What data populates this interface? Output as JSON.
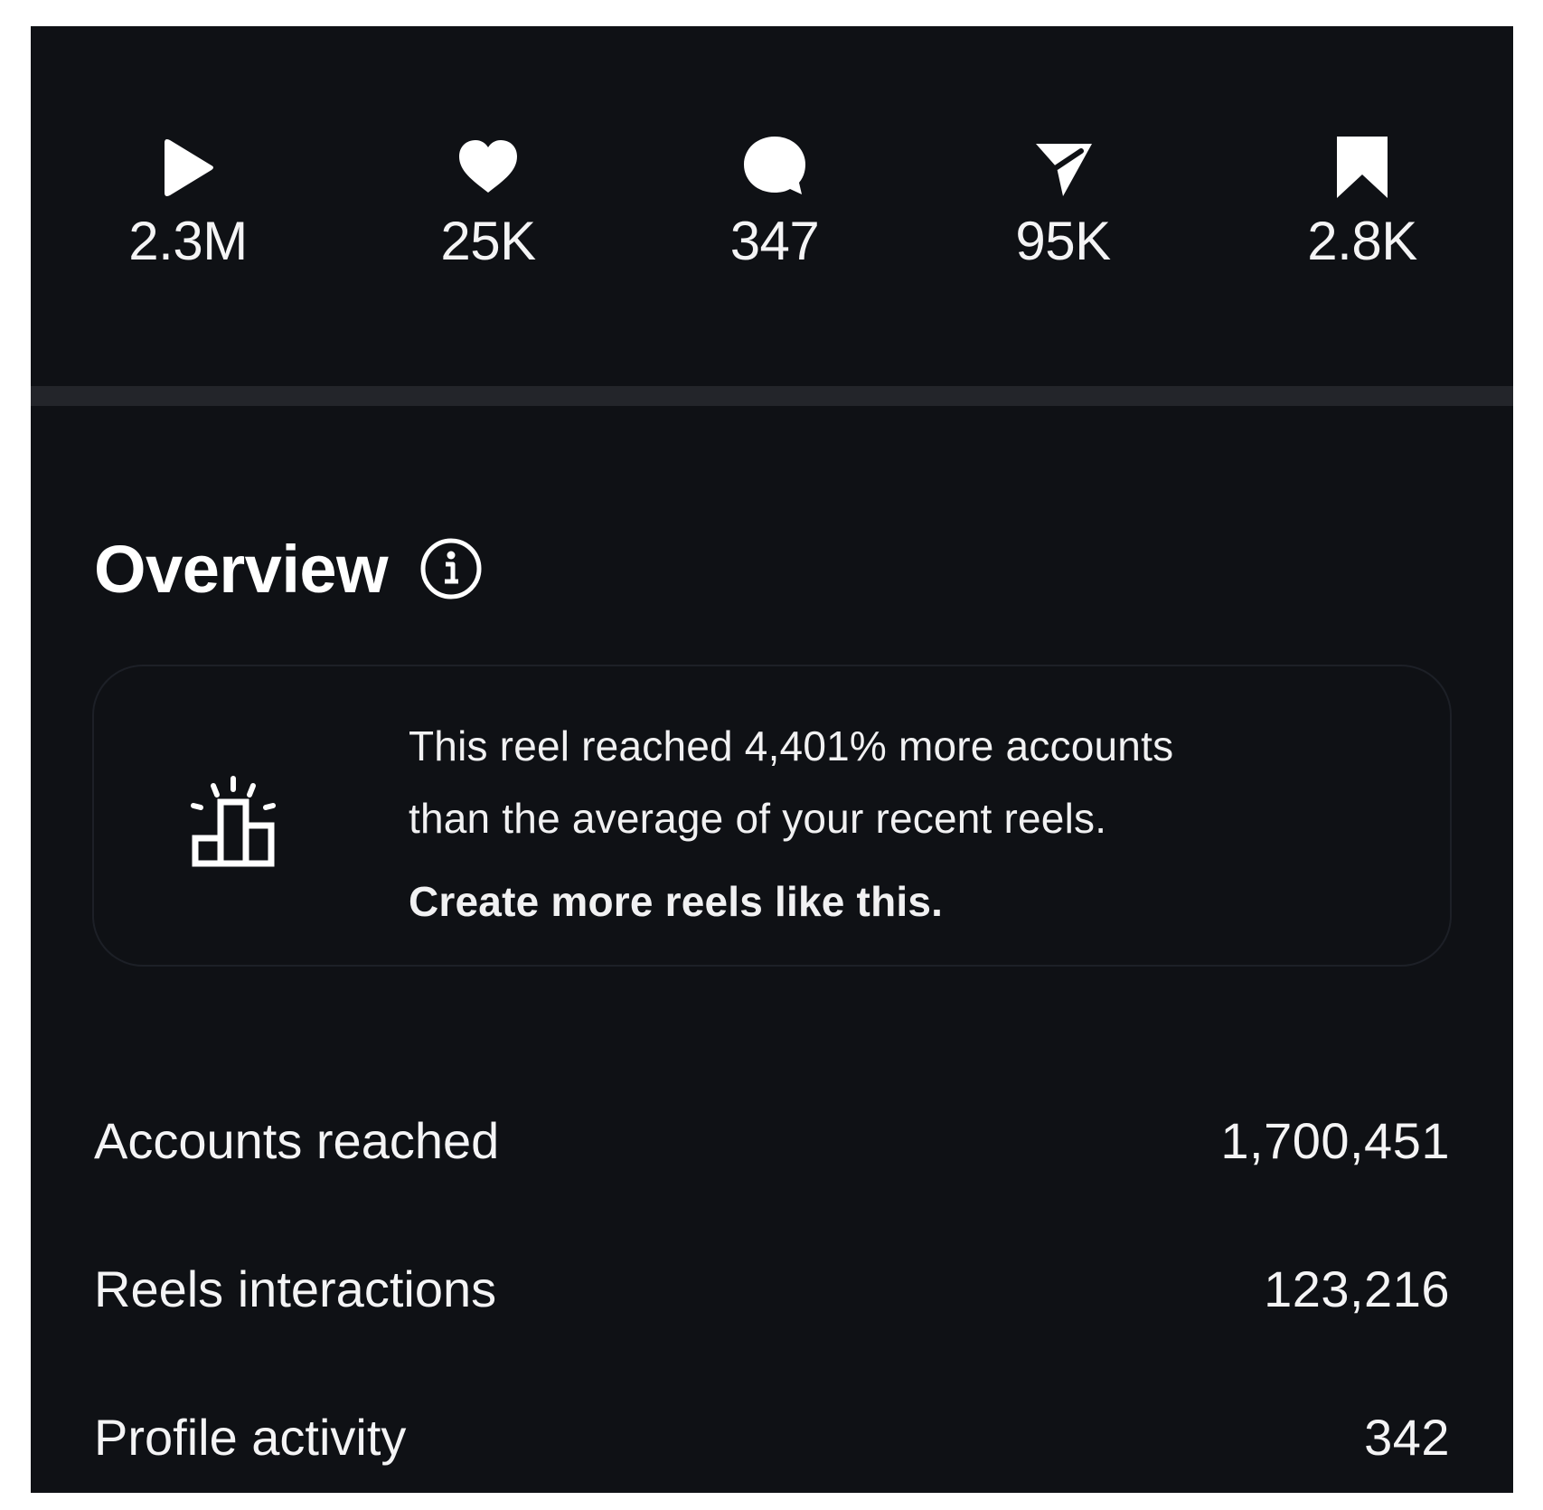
{
  "stats": [
    {
      "icon": "play-icon",
      "value": "2.3M"
    },
    {
      "icon": "heart-icon",
      "value": "25K"
    },
    {
      "icon": "comment-icon",
      "value": "347"
    },
    {
      "icon": "share-icon",
      "value": "95K"
    },
    {
      "icon": "bookmark-icon",
      "value": "2.8K"
    }
  ],
  "overview": {
    "title": "Overview",
    "info_icon": "info-icon"
  },
  "insight": {
    "icon": "podium-icon",
    "line1": "This reel reached 4,401% more accounts",
    "line2": "than the average of your recent reels.",
    "cta": "Create more reels like this."
  },
  "metrics": [
    {
      "label": "Accounts reached",
      "value": "1,700,451"
    },
    {
      "label": "Reels interactions",
      "value": "123,216"
    },
    {
      "label": "Profile activity",
      "value": "342"
    }
  ],
  "colors": {
    "page_background": "#ffffff",
    "panel_background": "#0f1115",
    "divider": "#23252a",
    "card_border": "#1d2027",
    "text": "#ffffff"
  }
}
